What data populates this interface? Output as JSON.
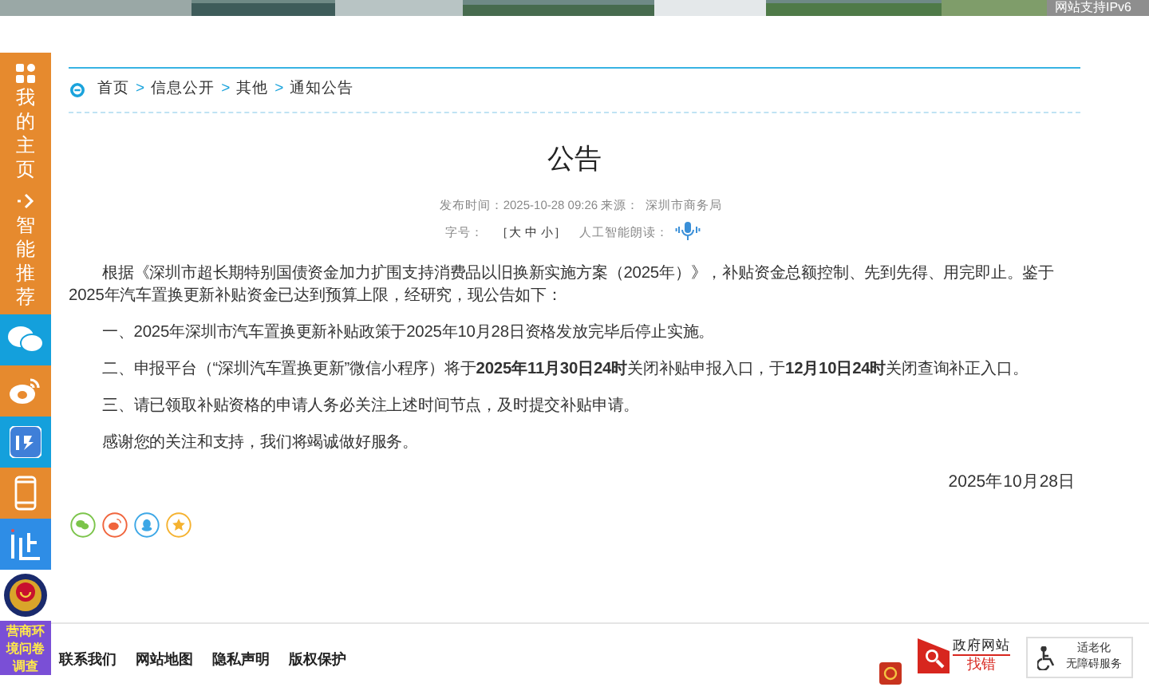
{
  "banner": {
    "badge": "网站支持IPv6"
  },
  "sidebar": [
    {
      "kind": "home",
      "label": "我的主页"
    },
    {
      "kind": "recommend",
      "label": "智能推荐"
    },
    {
      "kind": "wechat"
    },
    {
      "kind": "weibo"
    },
    {
      "kind": "app"
    },
    {
      "kind": "mobile"
    },
    {
      "kind": "verify"
    },
    {
      "kind": "emblem"
    },
    {
      "kind": "survey",
      "label": "营商环境问卷调查"
    }
  ],
  "breadcrumb": {
    "items": [
      "首页",
      "信息公开",
      "其他",
      "通知公告"
    ],
    "separator": ">"
  },
  "article": {
    "title": "公告",
    "meta_label": "发布时间：2025-10-28 09:26 来源：",
    "source": "深圳市商务局",
    "font_size_label": "字号：",
    "font_size_options": "［大 中 小］",
    "ai_read_label": "人工智能朗读：",
    "paragraphs": [
      "根据《深圳市超长期特别国债资金加力扩围支持消费品以旧换新实施方案（2025年）》，补贴资金总额控制、先到先得、用完即止。鉴于2025年汽车置换更新补贴资金已达到预算上限，经研究，现公告如下：",
      "一、2025年深圳市汽车置换更新补贴政策于2025年10月28日资格发放完毕后停止实施。",
      "二、申报平台（“深圳汽车置换更新”微信小程序）将于**2025年11月30日24时**关闭补贴申报入口，于**12月10日24时**关闭查询补正入口。",
      "三、请已领取补贴资格的申请人务必关注上述时间节点，及时提交补贴申请。",
      "感谢您的关注和支持，我们将竭诚做好服务。"
    ],
    "date": "2025年10月28日",
    "share": [
      {
        "kind": "wechat",
        "color": "#7bc44a"
      },
      {
        "kind": "weibo",
        "color": "#f0643c"
      },
      {
        "kind": "qq",
        "color": "#3ca7e6"
      },
      {
        "kind": "favorite",
        "color": "#f5b230"
      }
    ]
  },
  "footer": {
    "links": [
      "联系我们",
      "网站地图",
      "隐私声明",
      "版权保护"
    ],
    "error_badge": {
      "title": "政府网站",
      "action": "找错"
    },
    "accessibility_badge": {
      "line1": "适老化",
      "line2": "无障碍服务"
    }
  }
}
